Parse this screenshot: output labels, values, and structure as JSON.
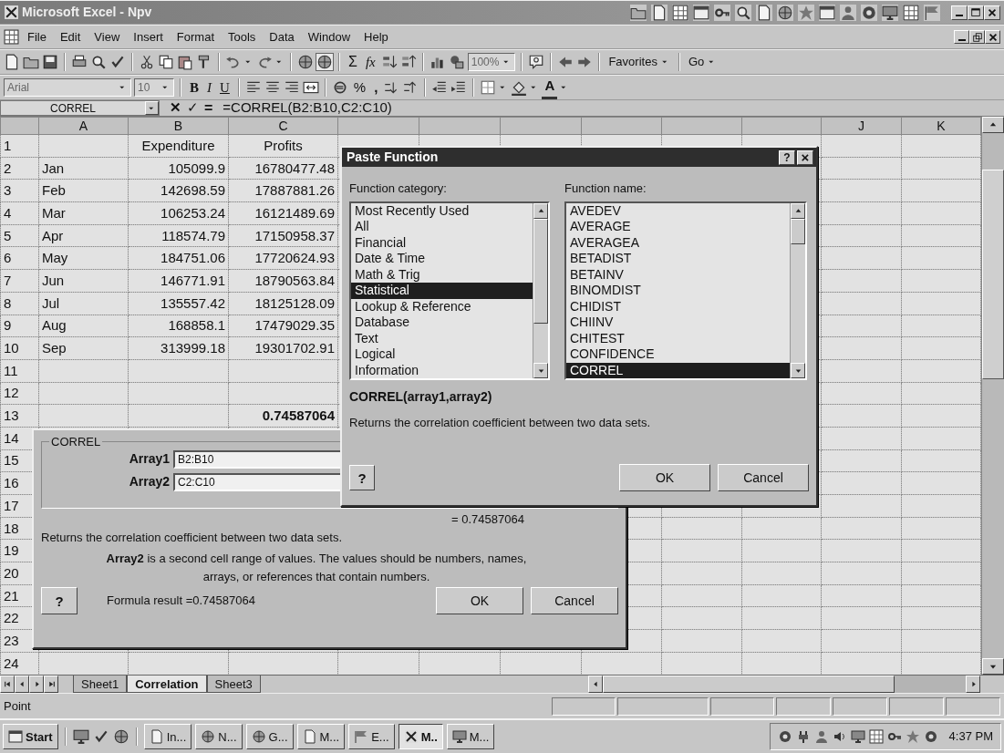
{
  "window": {
    "title": "Microsoft Excel - Npv"
  },
  "menu_bar": {
    "items": [
      "File",
      "Edit",
      "View",
      "Insert",
      "Format",
      "Tools",
      "Data",
      "Window",
      "Help"
    ]
  },
  "standard_toolbar": {
    "sum": "Σ",
    "function": "fx",
    "zoom": "100%",
    "favorites": "Favorites",
    "go": "Go"
  },
  "formatting_toolbar": {
    "font": "Arial",
    "size": "10",
    "bold": "B",
    "italic": "I",
    "underline": "U",
    "percent": "%",
    "comma": ",",
    "font_color": "A"
  },
  "formula_bar": {
    "name_box": "CORREL",
    "cancel": "✕",
    "enter": "✓",
    "equals": "=",
    "formula": "=CORREL(B2:B10,C2:C10)"
  },
  "sheet": {
    "column_headers_left": [
      "A",
      "B",
      "C"
    ],
    "column_headers_right": [
      "J",
      "K"
    ],
    "rows": [
      {
        "number": "1",
        "b": "Expenditure",
        "c": "Profits",
        "centered": true
      },
      {
        "number": "2",
        "a": "Jan",
        "b": "105099.9",
        "c": "16780477.48"
      },
      {
        "number": "3",
        "a": "Feb",
        "b": "142698.59",
        "c": "17887881.26"
      },
      {
        "number": "4",
        "a": "Mar",
        "b": "106253.24",
        "c": "16121489.69"
      },
      {
        "number": "5",
        "a": "Apr",
        "b": "118574.79",
        "c": "17150958.37"
      },
      {
        "number": "6",
        "a": "May",
        "b": "184751.06",
        "c": "17720624.93"
      },
      {
        "number": "7",
        "a": "Jun",
        "b": "146771.91",
        "c": "18790563.84"
      },
      {
        "number": "8",
        "a": "Jul",
        "b": "135557.42",
        "c": "18125128.09"
      },
      {
        "number": "9",
        "a": "Aug",
        "b": "168858.1",
        "c": "17479029.35"
      },
      {
        "number": "10",
        "a": "Sep",
        "b": "313999.18",
        "c": "19301702.91"
      },
      {
        "number": "11"
      },
      {
        "number": "12"
      },
      {
        "number": "13",
        "c": "0.74587064",
        "bold": true
      },
      {
        "number": "14"
      },
      {
        "number": "15"
      },
      {
        "number": "16"
      },
      {
        "number": "17"
      },
      {
        "number": "18"
      },
      {
        "number": "19"
      },
      {
        "number": "20"
      },
      {
        "number": "21"
      },
      {
        "number": "22"
      },
      {
        "number": "23"
      },
      {
        "number": "24"
      }
    ]
  },
  "sheet_tabs": [
    {
      "label": "Sheet1",
      "selected": false
    },
    {
      "label": "Correlation",
      "selected": true
    },
    {
      "label": "Sheet3",
      "selected": false
    }
  ],
  "status_bar": {
    "text": "Point"
  },
  "paste_function": {
    "title": "Paste Function",
    "title_help": "?",
    "close": "×",
    "category_label": "Function category:",
    "categories": [
      {
        "label": "Most Recently Used",
        "selected": false
      },
      {
        "label": "All",
        "selected": false
      },
      {
        "label": "Financial",
        "selected": false
      },
      {
        "label": "Date & Time",
        "selected": false
      },
      {
        "label": "Math & Trig",
        "selected": false
      },
      {
        "label": "Statistical",
        "selected": true
      },
      {
        "label": "Lookup & Reference",
        "selected": false
      },
      {
        "label": "Database",
        "selected": false
      },
      {
        "label": "Text",
        "selected": false
      },
      {
        "label": "Logical",
        "selected": false
      },
      {
        "label": "Information",
        "selected": false
      }
    ],
    "name_label": "Function name:",
    "functions": [
      {
        "label": "AVEDEV",
        "selected": false
      },
      {
        "label": "AVERAGE",
        "selected": false
      },
      {
        "label": "AVERAGEA",
        "selected": false
      },
      {
        "label": "BETADIST",
        "selected": false
      },
      {
        "label": "BETAINV",
        "selected": false
      },
      {
        "label": "BINOMDIST",
        "selected": false
      },
      {
        "label": "CHIDIST",
        "selected": false
      },
      {
        "label": "CHIINV",
        "selected": false
      },
      {
        "label": "CHITEST",
        "selected": false
      },
      {
        "label": "CONFIDENCE",
        "selected": false
      },
      {
        "label": "CORREL",
        "selected": true
      }
    ],
    "signature": "CORREL(array1,array2)",
    "description": "Returns the correlation coefficient between two data sets.",
    "help_button": "?",
    "ok": "OK",
    "cancel": "Cancel"
  },
  "formula_palette": {
    "group": "CORREL",
    "args": [
      {
        "label": "Array1",
        "value": "B2:B10"
      },
      {
        "label": "Array2",
        "value": "C2:C10"
      }
    ],
    "result_preview": "= 0.74587064",
    "description": "Returns the correlation coefficient between two data sets.",
    "arg_help": "**Array2** is a second cell range of values. The values should be numbers, names, arrays, or references that contain numbers.",
    "help_button": "?",
    "formula_result": "Formula result =0.74587064",
    "ok": "OK",
    "cancel": "Cancel"
  },
  "taskbar": {
    "start": "Start",
    "tasks": [
      {
        "label": "In...",
        "selected": false
      },
      {
        "label": "N...",
        "selected": false
      },
      {
        "label": "G...",
        "selected": false
      },
      {
        "label": "M...",
        "selected": false
      },
      {
        "label": "E...",
        "selected": false
      },
      {
        "label": "M..",
        "selected": true
      },
      {
        "label": "M...",
        "selected": false
      }
    ],
    "clock": "4:37 PM"
  }
}
